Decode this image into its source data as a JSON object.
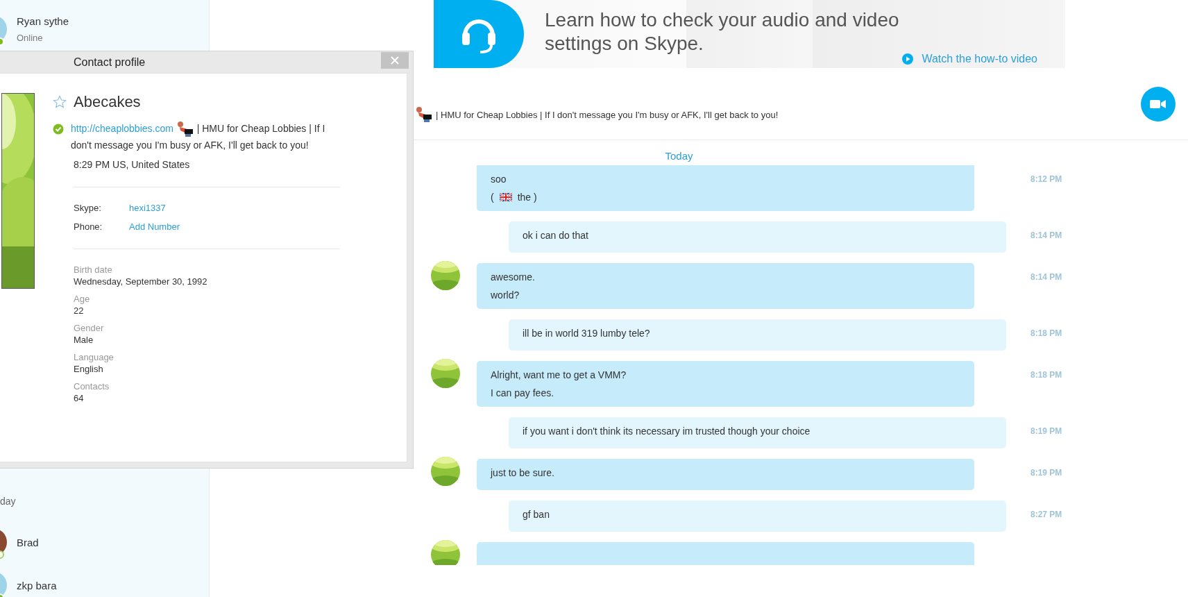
{
  "sidebar": {
    "top_contacts": [
      {
        "name": "Ryan sythe",
        "status_text": "Online",
        "away": false,
        "color": "#9fd3ea"
      }
    ],
    "section_label": "day",
    "bottom_contacts": [
      {
        "name": "Brad",
        "away": true,
        "color": "#8a4a32"
      },
      {
        "name": "zkp bara",
        "away": false,
        "color": "#9fd3ea"
      }
    ]
  },
  "ad": {
    "headline": "Learn how to check your audio and video settings on Skype.",
    "link": "Watch the how-to video"
  },
  "conversation_header": {
    "mood": "| HMU for Cheap Lobbies | If I don't message you I'm busy or AFK, I'll get back to you!"
  },
  "chat": {
    "date_label": "Today",
    "messages": [
      {
        "kind": "incoming",
        "avatar": false,
        "time": "8:12 PM",
        "lines": [
          {
            "kind": "text",
            "text": "soo"
          },
          {
            "kind": "flag",
            "before": "(",
            "after": "the )"
          }
        ]
      },
      {
        "kind": "outgoing",
        "avatar": false,
        "time": "8:14 PM",
        "lines": [
          {
            "kind": "text",
            "text": "ok i can do that"
          }
        ]
      },
      {
        "kind": "incoming",
        "avatar": true,
        "time": "8:14 PM",
        "lines": [
          {
            "kind": "text",
            "text": "awesome."
          },
          {
            "kind": "text",
            "text": "world?"
          }
        ]
      },
      {
        "kind": "outgoing",
        "avatar": false,
        "time": "8:18 PM",
        "lines": [
          {
            "kind": "text",
            "text": "ill be in world 319 lumby tele?"
          }
        ]
      },
      {
        "kind": "incoming",
        "avatar": true,
        "time": "8:18 PM",
        "lines": [
          {
            "kind": "text",
            "text": "Alright, want me to get a VMM?"
          },
          {
            "kind": "text",
            "text": "I can pay fees."
          }
        ]
      },
      {
        "kind": "outgoing",
        "avatar": false,
        "time": "8:19 PM",
        "lines": [
          {
            "kind": "text",
            "text": "if you want i don't think its necessary im trusted though your choice"
          }
        ]
      },
      {
        "kind": "incoming",
        "avatar": true,
        "time": "8:19 PM",
        "lines": [
          {
            "kind": "text",
            "text": "just to be sure."
          }
        ]
      },
      {
        "kind": "outgoing",
        "avatar": false,
        "time": "8:27 PM",
        "lines": [
          {
            "kind": "text",
            "text": "gf ban"
          }
        ]
      },
      {
        "kind": "incoming",
        "avatar": true
      }
    ]
  },
  "profile_dialog": {
    "title": "Contact profile",
    "name": "Abecakes",
    "favorite": false,
    "online": true,
    "mood_link": "http://cheaplobbies.com",
    "mood": "| HMU for Cheap Lobbies | If I don't message you I'm busy or AFK, I'll get back to you!",
    "local_time": "8:29 PM US, United States",
    "accounts": [
      {
        "label": "Skype:",
        "value": "hexi1337"
      },
      {
        "label": "Phone:",
        "value": "Add Number"
      }
    ],
    "details": [
      {
        "label": "Birth date",
        "value": "Wednesday, September 30, 1992"
      },
      {
        "label": "Age",
        "value": "22"
      },
      {
        "label": "Gender",
        "value": "Male"
      },
      {
        "label": "Language",
        "value": "English"
      },
      {
        "label": "Contacts",
        "value": "64"
      }
    ]
  }
}
